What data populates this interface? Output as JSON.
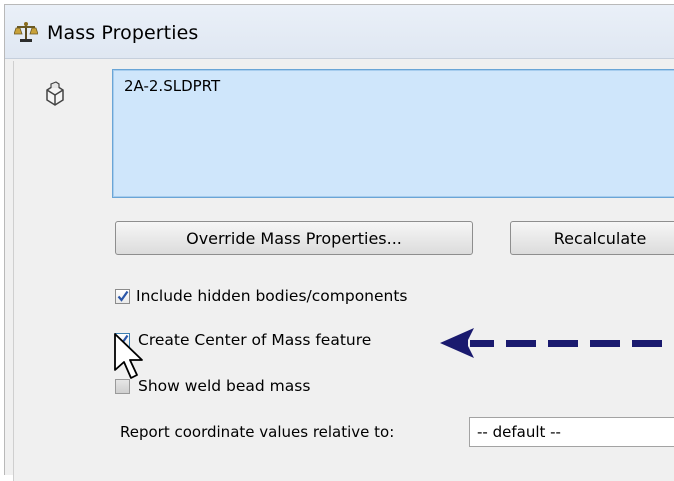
{
  "window": {
    "title": "Mass Properties",
    "title_icon": "balance-scale-icon"
  },
  "selection": {
    "icon": "part-icon",
    "items": [
      "2A-2.SLDPRT"
    ]
  },
  "buttons": {
    "override_label": "Override Mass Properties...",
    "recalculate_label": "Recalculate"
  },
  "options": [
    {
      "label": "Include hidden bodies/components",
      "checked": true
    },
    {
      "label": "Create Center of Mass feature",
      "checked": true
    },
    {
      "label": "Show weld bead mass",
      "checked": false
    }
  ],
  "coordinates": {
    "label": "Report coordinate values relative to:",
    "selected_value": "-- default --"
  },
  "annotation": {
    "icon": "dashed-arrow-left-icon",
    "color": "#1a1a6e"
  },
  "cursor": {
    "icon": "mouse-pointer-icon"
  }
}
